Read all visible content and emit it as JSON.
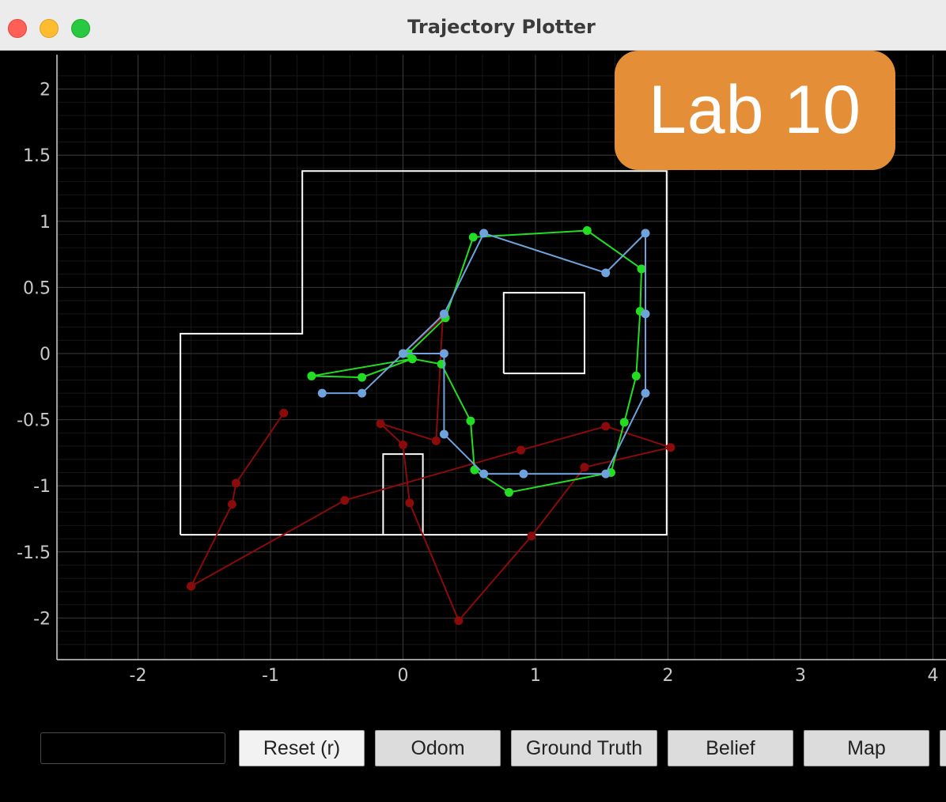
{
  "window": {
    "title": "Trajectory Plotter"
  },
  "badge": {
    "label": "Lab 10",
    "color": "#e48f38"
  },
  "toolbar": {
    "reset_label": "Reset (r)",
    "odom_label": "Odom",
    "ground_truth_label": "Ground Truth",
    "belief_label": "Belief",
    "map_label": "Map"
  },
  "chart_data": {
    "type": "line",
    "title": "",
    "xlabel": "",
    "ylabel": "",
    "xlim": [
      -2.6,
      4.0
    ],
    "ylim": [
      -2.3,
      2.2
    ],
    "xticks": [
      "-2",
      "-1",
      "0",
      "1",
      "2",
      "3",
      "4"
    ],
    "yticks": [
      "2",
      "1.5",
      "1",
      "0.5",
      "0",
      "-0.5",
      "-1",
      "-1.5",
      "-2"
    ],
    "grid": true,
    "series": [
      {
        "key": "odom",
        "color": "#8b0a0a",
        "points": [
          [
            0,
            0
          ],
          [
            0.3,
            0.27
          ],
          [
            0.25,
            -0.66
          ],
          [
            -0.17,
            -0.53
          ],
          [
            0,
            -0.69
          ],
          [
            0.05,
            -1.13
          ],
          [
            0.42,
            -2.02
          ],
          [
            0.97,
            -1.38
          ],
          [
            1.37,
            -0.86
          ],
          [
            2.02,
            -0.71
          ],
          [
            1.53,
            -0.55
          ],
          [
            0.89,
            -0.73
          ],
          [
            -0.44,
            -1.11
          ],
          [
            -1.6,
            -1.76
          ],
          [
            -1.29,
            -1.14
          ],
          [
            -1.26,
            -0.98
          ],
          [
            -0.9,
            -0.45
          ]
        ]
      },
      {
        "key": "ground_truth",
        "color": "#22dd22",
        "points": [
          [
            0,
            0
          ],
          [
            0.07,
            -0.04
          ],
          [
            -0.31,
            -0.18
          ],
          [
            -0.69,
            -0.17
          ],
          [
            0.07,
            -0.04
          ],
          [
            0.29,
            -0.08
          ],
          [
            0.51,
            -0.51
          ],
          [
            0.54,
            -0.88
          ],
          [
            0.8,
            -1.05
          ],
          [
            1.57,
            -0.9
          ],
          [
            1.67,
            -0.52
          ],
          [
            1.76,
            -0.17
          ],
          [
            1.79,
            0.32
          ],
          [
            1.8,
            0.64
          ],
          [
            1.39,
            0.93
          ],
          [
            0.53,
            0.88
          ],
          [
            0.32,
            0.27
          ],
          [
            0.04,
            0.0
          ]
        ]
      },
      {
        "key": "belief",
        "color": "#6fa3dd",
        "points": [
          [
            0,
            0
          ],
          [
            0.31,
            0
          ],
          [
            0.31,
            -0.61
          ],
          [
            0.61,
            -0.91
          ],
          [
            0.91,
            -0.91
          ],
          [
            1.53,
            -0.91
          ],
          [
            1.83,
            -0.3
          ],
          [
            1.83,
            0.3
          ],
          [
            1.83,
            0.91
          ],
          [
            1.53,
            0.61
          ],
          [
            0.61,
            0.91
          ],
          [
            0.31,
            0.3
          ],
          [
            0,
            0
          ],
          [
            -0.31,
            -0.3
          ],
          [
            -0.61,
            -0.3
          ]
        ]
      }
    ],
    "map": {
      "color": "#ffffff",
      "walls": [
        [
          [
            -1.68,
            -1.37
          ],
          [
            -1.68,
            0.15
          ],
          [
            -0.76,
            0.15
          ],
          [
            -0.76,
            1.38
          ],
          [
            1.99,
            1.38
          ],
          [
            1.99,
            -1.37
          ],
          [
            -1.68,
            -1.37
          ]
        ],
        [
          [
            0.76,
            -0.15
          ],
          [
            1.37,
            -0.15
          ],
          [
            1.37,
            0.46
          ],
          [
            0.76,
            0.46
          ],
          [
            0.76,
            -0.15
          ]
        ],
        [
          [
            -0.15,
            -1.37
          ],
          [
            -0.15,
            -0.76
          ],
          [
            0.15,
            -0.76
          ],
          [
            0.15,
            -1.37
          ]
        ]
      ]
    }
  }
}
